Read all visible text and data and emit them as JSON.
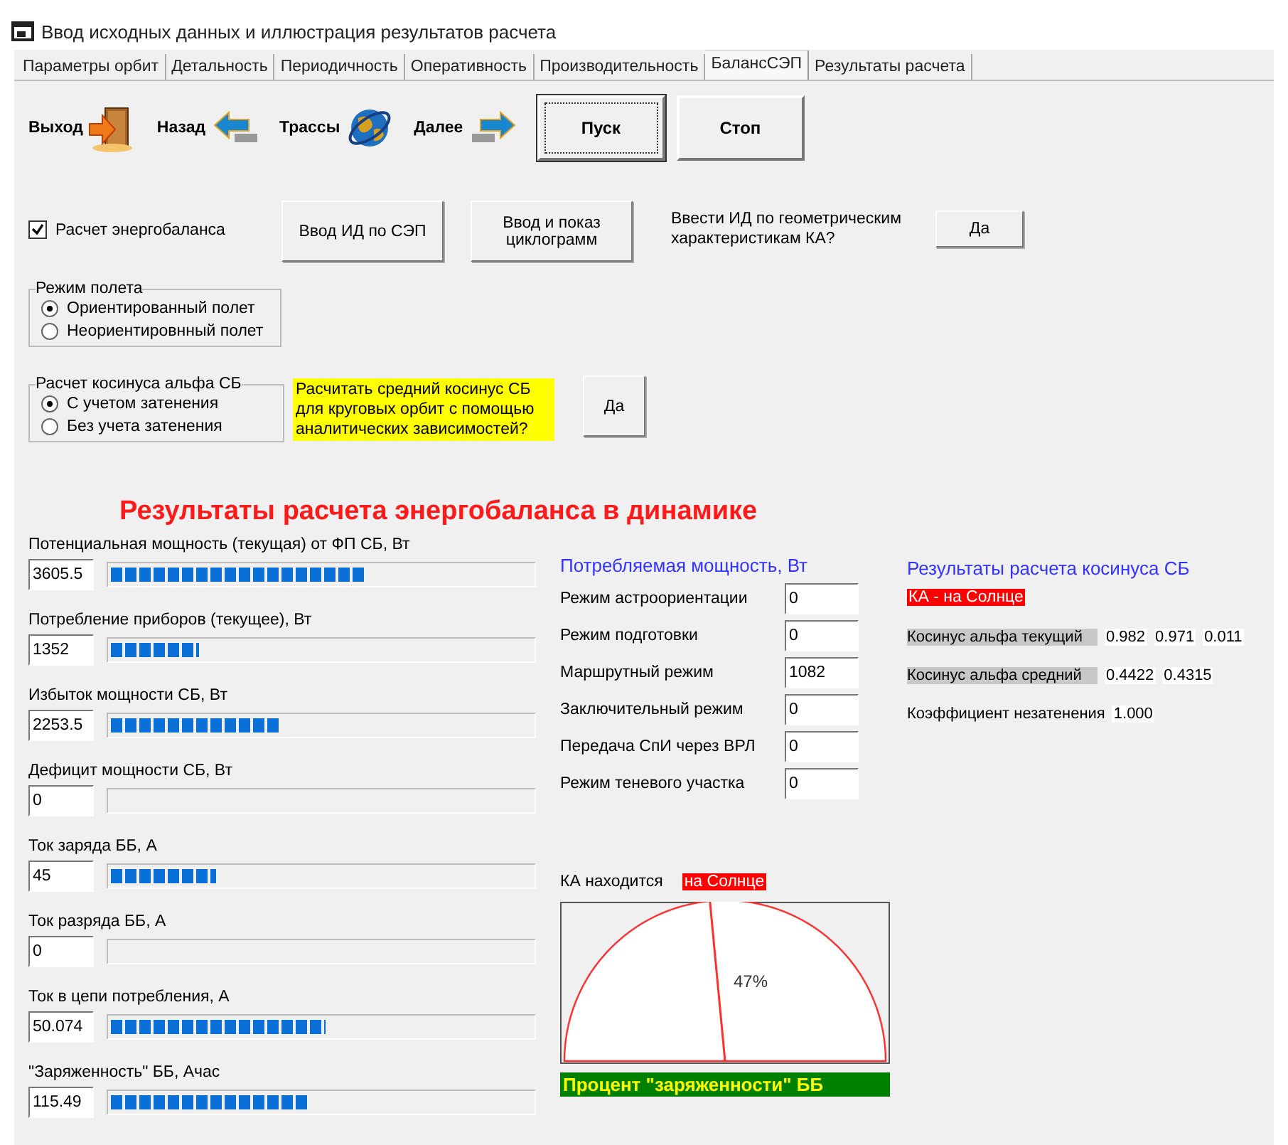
{
  "window": {
    "title": "Ввод исходных данных и иллюстрация результатов расчета"
  },
  "tabs": [
    {
      "label": "Параметры орбит",
      "selected": false
    },
    {
      "label": "Детальность",
      "selected": false
    },
    {
      "label": "Периодичность",
      "selected": false
    },
    {
      "label": "Оперативность",
      "selected": false
    },
    {
      "label": "Производительность",
      "selected": false
    },
    {
      "label": "БалансСЭП",
      "selected": true
    },
    {
      "label": "Результаты расчета",
      "selected": false
    }
  ],
  "toolbar": {
    "nav": [
      {
        "kind": "exit",
        "label": "Выход"
      },
      {
        "kind": "back",
        "label": "Назад"
      },
      {
        "kind": "tracks",
        "label": "Трассы"
      },
      {
        "kind": "next",
        "label": "Далее"
      }
    ],
    "buttons": [
      {
        "label": "Пуск",
        "focused": true
      },
      {
        "label": "Стоп",
        "focused": false
      }
    ]
  },
  "energy_balance": {
    "checkbox": {
      "label": "Расчет энергобаланса",
      "checked": true
    },
    "buttons": [
      {
        "lines": [
          "Ввод ИД по СЭП"
        ]
      },
      {
        "lines": [
          "Ввод и показ",
          "циклограмм"
        ]
      }
    ]
  },
  "geometry_prompt": {
    "text": "Ввести ИД по геометрическим характеристикам КА?",
    "button": "Да"
  },
  "flight_mode": {
    "title": "Режим полета",
    "options": [
      {
        "label": "Ориентированный полет",
        "selected": true
      },
      {
        "label": "Неориентировнный полет",
        "selected": false
      }
    ]
  },
  "cosine_mode": {
    "title": "Расчет косинуса альфа СБ",
    "options": [
      {
        "label": "С учетом затенения",
        "selected": true
      },
      {
        "label": "Без учета затенения",
        "selected": false
      }
    ]
  },
  "analytic_prompt": {
    "text": "Расчитать средний косинус СБ для круговых орбит с помощью аналитических зависимостей?",
    "button": "Да"
  },
  "results_title": "Результаты расчета энергобаланса в динамике",
  "meters": [
    {
      "label": "Потенциальная мощность (текущая) от ФП СБ,  Вт",
      "value": "3605.5",
      "level": 0.6
    },
    {
      "label": "Потребление приборов (текущее), Вт",
      "value": "1352",
      "level": 0.21
    },
    {
      "label": "Избыток мощности СБ, Вт",
      "value": "2253.5",
      "level": 0.4
    },
    {
      "label": "Дефицит мощности  СБ, Вт",
      "value": "0"
    },
    {
      "label": "Ток заряда ББ, А",
      "value": "45",
      "level": 0.25
    },
    {
      "label": "Ток разряда ББ, А",
      "value": "0"
    },
    {
      "label": "Ток в цепи потребления, А",
      "value": "50.074",
      "level": 0.51
    },
    {
      "label": "\"Заряженность\" ББ, Ачас",
      "value": "115.49",
      "level": 0.47
    }
  ],
  "consumption": {
    "title": "Потребляемая мощность, Вт",
    "rows": [
      {
        "label": "Режим астроориентации",
        "value": "0"
      },
      {
        "label": "Режим подготовки",
        "value": "0"
      },
      {
        "label": "Маршрутный режим",
        "value": "1082"
      },
      {
        "label": "Заключительный режим",
        "value": "0"
      },
      {
        "label": "Передача СпИ через ВРЛ",
        "value": "0"
      },
      {
        "label": "Режим теневого участка",
        "value": "0"
      }
    ]
  },
  "cosine_results": {
    "title": "Результаты расчета косинуса СБ",
    "status": "КА - на Солнце",
    "rows": [
      {
        "label": "Косинус альфа текущий",
        "highlighted": true,
        "values": [
          "0.982",
          "0.971",
          "0.011"
        ]
      },
      {
        "label": "Косинус альфа средний",
        "highlighted": true,
        "values": [
          "0.4422",
          "0.4315"
        ]
      },
      {
        "label": "Коэффициент незатенения",
        "highlighted": false,
        "values": [
          "1.000"
        ]
      }
    ]
  },
  "location": {
    "label": "КА находится",
    "status": "на Солнце"
  },
  "charge_gauge": {
    "level": 0.47,
    "reading": "47%",
    "caption": "Процент \"заряженности\" ББ"
  }
}
